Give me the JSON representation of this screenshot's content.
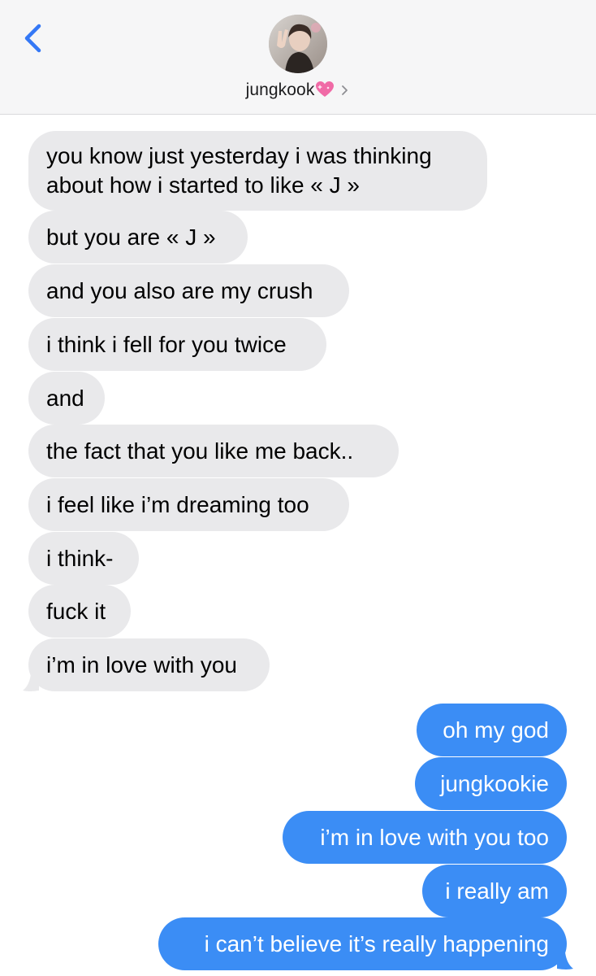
{
  "header": {
    "contact_name": "jungkook",
    "back_icon": "chevron-left-icon",
    "heart_icon": "sparkling-heart-icon",
    "details_icon": "chevron-right-icon",
    "accent_color": "#3478f6"
  },
  "messages": {
    "received": [
      "you know just yesterday i was thinking about how i started to like « J »",
      "but you are « J »",
      "and you also are my crush",
      "i think i fell for you twice",
      "and",
      "the fact that you like me back..",
      "i feel like i’m dreaming too",
      "i think-",
      "fuck it",
      "i’m in love with you"
    ],
    "sent": [
      "oh my god",
      "jungkookie",
      "i’m in love with you too",
      "i really am",
      "i can’t believe it’s really happening"
    ]
  },
  "colors": {
    "received_bubble": "#e9e9eb",
    "sent_bubble": "#3b8df5",
    "header_bg": "#f6f6f7"
  }
}
